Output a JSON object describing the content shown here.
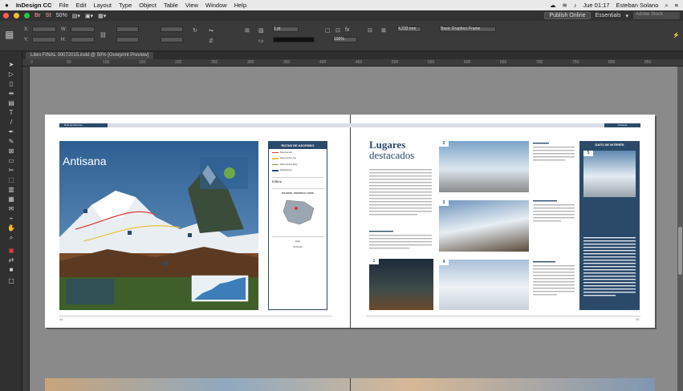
{
  "menubar": {
    "apple": "",
    "app_name": "InDesign CC",
    "items": [
      "File",
      "Edit",
      "Layout",
      "Type",
      "Object",
      "Table",
      "View",
      "Window",
      "Help"
    ],
    "clock": "Jue 01:17",
    "user": "Esteban Solano"
  },
  "appbar": {
    "zoom": "50%",
    "publish_label": "Publish Online",
    "workspace_label": "Essentials",
    "search_placeholder": "Adobe Stock"
  },
  "control": {
    "x_label": "X:",
    "y_label": "Y:",
    "w_label": "W:",
    "h_label": "H:",
    "stroke_weight": "1 pt",
    "opacity": "100%",
    "size_value": "4,233 mm",
    "frame_preset": "Basic Graphics Frame"
  },
  "document": {
    "tab_title": "Libro FINAL 30072015.indd @ 50% [Overprint Preview]"
  },
  "ruler": {
    "marks": [
      "0",
      "50",
      "100",
      "150",
      "200",
      "250",
      "300",
      "350",
      "400",
      "450",
      "500",
      "550",
      "600",
      "650",
      "700",
      "750",
      "800",
      "850"
    ]
  },
  "tools": [
    "selection",
    "direct-selection",
    "page",
    "gap",
    "content-collector",
    "type",
    "line",
    "pen",
    "pencil",
    "rectangle-frame",
    "rectangle",
    "scissors",
    "free-transform",
    "gradient-swatch",
    "gradient-feather",
    "note",
    "eyedropper",
    "hand",
    "zoom",
    "fill-stroke",
    "swap",
    "apply-color",
    "view-mode"
  ],
  "left_page": {
    "header_tag": "Ruta de Ascenso",
    "poster_title": "Antisana",
    "legend": {
      "title": "RUTAS DE ASCENSO",
      "routes": [
        "Ruta Normal",
        "Ruta Cumbre Sur",
        "Ruta Cumbre Este",
        "Ruta Directa"
      ],
      "elevation": "5.758 m",
      "map_title": "ECUADOR - PROVINCIA Y MAPA",
      "contact": [
        "Quito",
        "Pichincha"
      ]
    },
    "folio": "34"
  },
  "right_page": {
    "header_tag": "Antisana",
    "title_line1": "Lugares",
    "title_line2": "destacados",
    "photo_nums": [
      "1",
      "2",
      "3",
      "4",
      "5"
    ],
    "side_head": "DATO DE INTERÉS",
    "folio": "35"
  }
}
